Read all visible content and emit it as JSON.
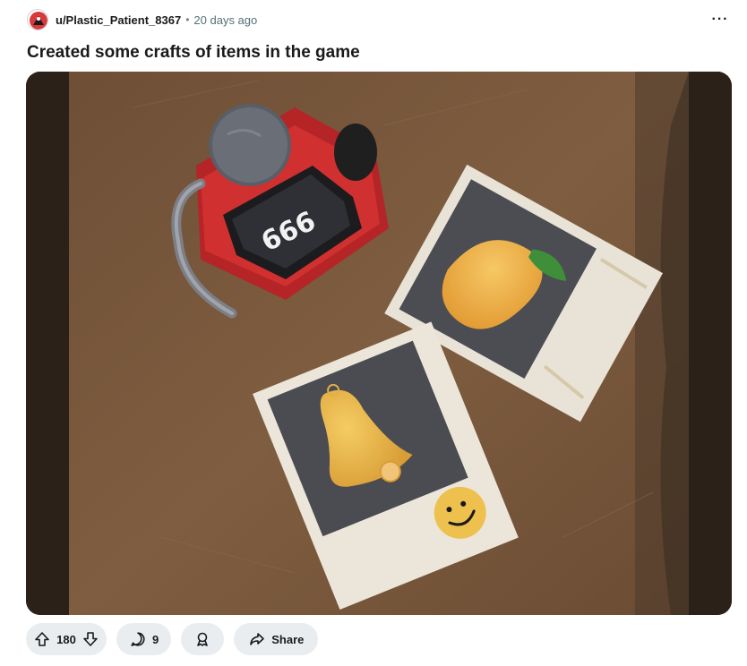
{
  "post": {
    "author": "u/Plastic_Patient_8367",
    "separator": "•",
    "age": "20 days ago",
    "more_label": "···",
    "title": "Created some crafts of items in the game"
  },
  "actions": {
    "score": "180",
    "comments": "9",
    "share_label": "Share"
  },
  "icons": {
    "avatar": "avatar-icon",
    "more": "more-options-icon",
    "upvote": "upvote-arrow-icon",
    "downvote": "downvote-arrow-icon",
    "comment": "comment-bubble-icon",
    "award": "award-icon",
    "share": "share-arrow-icon"
  },
  "image": {
    "card_text": "666"
  },
  "colors": {
    "action_pill": "#eaedef",
    "text_primary": "#1a1a1b",
    "text_meta": "#576f76",
    "cardboard": "#7b5a3d",
    "robot_red": "#c9282b",
    "card_white": "#ede8dd",
    "card_gray": "#4a4c52",
    "fruit_yellow": "#e8b54a",
    "leaf_green": "#3f8f3a"
  }
}
